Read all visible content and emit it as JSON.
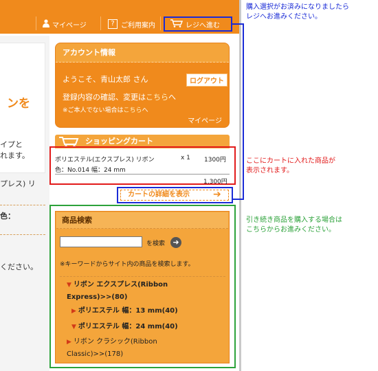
{
  "topbar": {
    "mypage": "マイページ",
    "guide": "ご利用案内",
    "register": "レジへ進む"
  },
  "left": {
    "badge": "ンを",
    "text1": "イプと",
    "text2": "れます。",
    "text3": "プレス) リ",
    "text4": "色：",
    "text5": "ください。"
  },
  "account": {
    "title": "アカウント情報",
    "welcome": "ようこそ、青山太郎 さん",
    "logout": "ログアウト",
    "edit_prefix": "登録内容の確認、変更は",
    "edit_link": "こちら",
    "edit_suffix": "へ",
    "note_prefix": "※ご本人でない場合は",
    "note_link": "こちら",
    "note_suffix": "へ",
    "mypage": "マイページ"
  },
  "cart": {
    "title": "ショッピングカート",
    "item_name": "ポリエステル(エクスプレス) リボン",
    "qty": "x 1",
    "price": "1300円",
    "spec": "色：No.014 幅：24 mm",
    "total": "1,300円",
    "detail_button": "カートの詳細を表示"
  },
  "search": {
    "title": "商品検索",
    "button": "を検索",
    "note": "※キーワードからサイト内の商品を検索します。",
    "categories": [
      {
        "name": "リボン エクスプレス(Ribbon",
        "name2": "Express)>>(80)"
      },
      {
        "name": "ポリエステル 幅：13 mm(40)"
      },
      {
        "name": "ポリエステル 幅：24 mm(40)"
      },
      {
        "name": "リボン クラシック(Ribbon",
        "name2": "Classic)>>(178)"
      }
    ]
  },
  "annotations": {
    "a1_line1": "購入選択がお済みになりましたら",
    "a1_line2": "レジへお進みください。",
    "a2_line1": "ここにカートに入れた商品が",
    "a2_line2": "表示されます。",
    "a3_line1": "引き続き商品を購入する場合は",
    "a3_line2": "こちらからお進みください。"
  },
  "colors": {
    "orange": "#f08a1c",
    "blue_annotation": "#1a2bd6",
    "red_annotation": "#e21a1a",
    "green_annotation": "#2ca23a"
  }
}
